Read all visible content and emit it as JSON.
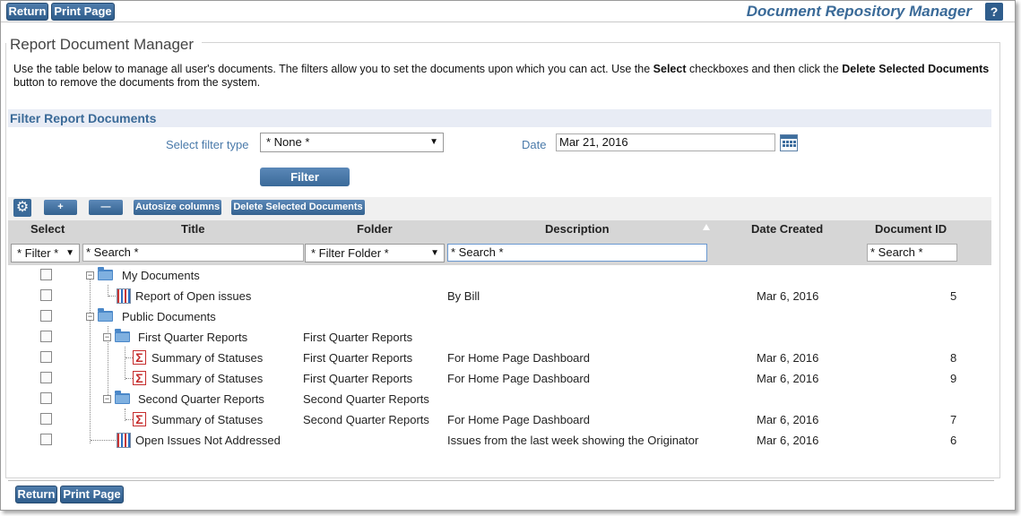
{
  "topbar": {
    "return_label": "Return",
    "print_label": "Print Page",
    "app_title": "Document Repository Manager",
    "help_label": "?"
  },
  "panel": {
    "title": "Report Document Manager",
    "intro_part1": "Use the table below to manage all user's documents. The filters allow you to set the documents upon which you can act. Use the ",
    "intro_bold1": "Select",
    "intro_part2": " checkboxes and then click the ",
    "intro_bold2": "Delete Selected Documents",
    "intro_part3": " button to remove the documents from the system."
  },
  "filters": {
    "heading": "Filter Report Documents",
    "filter_type_label": "Select filter type",
    "filter_type_value": "* None *",
    "date_label": "Date",
    "date_value": "Mar 21, 2016",
    "filter_button": "Filter"
  },
  "toolbar": {
    "add_label": "+",
    "remove_label": "—",
    "autosize_label": "Autosize columns",
    "delete_label": "Delete Selected Documents"
  },
  "columns": {
    "select": "Select",
    "title": "Title",
    "folder": "Folder",
    "description": "Description",
    "date_created": "Date Created",
    "document_id": "Document ID"
  },
  "column_filters": {
    "select": "* Filter *",
    "title": "* Search *",
    "folder": "* Filter Folder *",
    "description": "* Search *",
    "document_id": "* Search *"
  },
  "rows": [
    {
      "title": "My Documents",
      "folder": "",
      "description": "",
      "date": "",
      "id": "",
      "icon": "folder-icon"
    },
    {
      "title": "Report of Open issues",
      "folder": "",
      "description": "By Bill",
      "date": "Mar 6, 2016",
      "id": "5",
      "icon": "report-icon"
    },
    {
      "title": "Public Documents",
      "folder": "",
      "description": "",
      "date": "",
      "id": "",
      "icon": "folder-icon"
    },
    {
      "title": "First Quarter Reports",
      "folder": "First Quarter Reports",
      "description": "",
      "date": "",
      "id": "",
      "icon": "folder-icon"
    },
    {
      "title": "Summary of Statuses",
      "folder": "First Quarter Reports",
      "description": "For Home Page Dashboard",
      "date": "Mar 6, 2016",
      "id": "8",
      "icon": "sigma-icon"
    },
    {
      "title": "Summary of Statuses",
      "folder": "First Quarter Reports",
      "description": "For Home Page Dashboard",
      "date": "Mar 6, 2016",
      "id": "9",
      "icon": "sigma-icon"
    },
    {
      "title": "Second Quarter Reports",
      "folder": "Second Quarter Reports",
      "description": "",
      "date": "",
      "id": "",
      "icon": "folder-icon"
    },
    {
      "title": "Summary of Statuses",
      "folder": "Second Quarter Reports",
      "description": "For Home Page Dashboard",
      "date": "Mar 6, 2016",
      "id": "7",
      "icon": "sigma-icon"
    },
    {
      "title": "Open Issues Not Addressed",
      "folder": "",
      "description": "Issues from the last week showing the Originator",
      "date": "Mar 6, 2016",
      "id": "6",
      "icon": "report-icon"
    }
  ],
  "bottombar": {
    "return_label": "Return",
    "print_label": "Print Page"
  }
}
